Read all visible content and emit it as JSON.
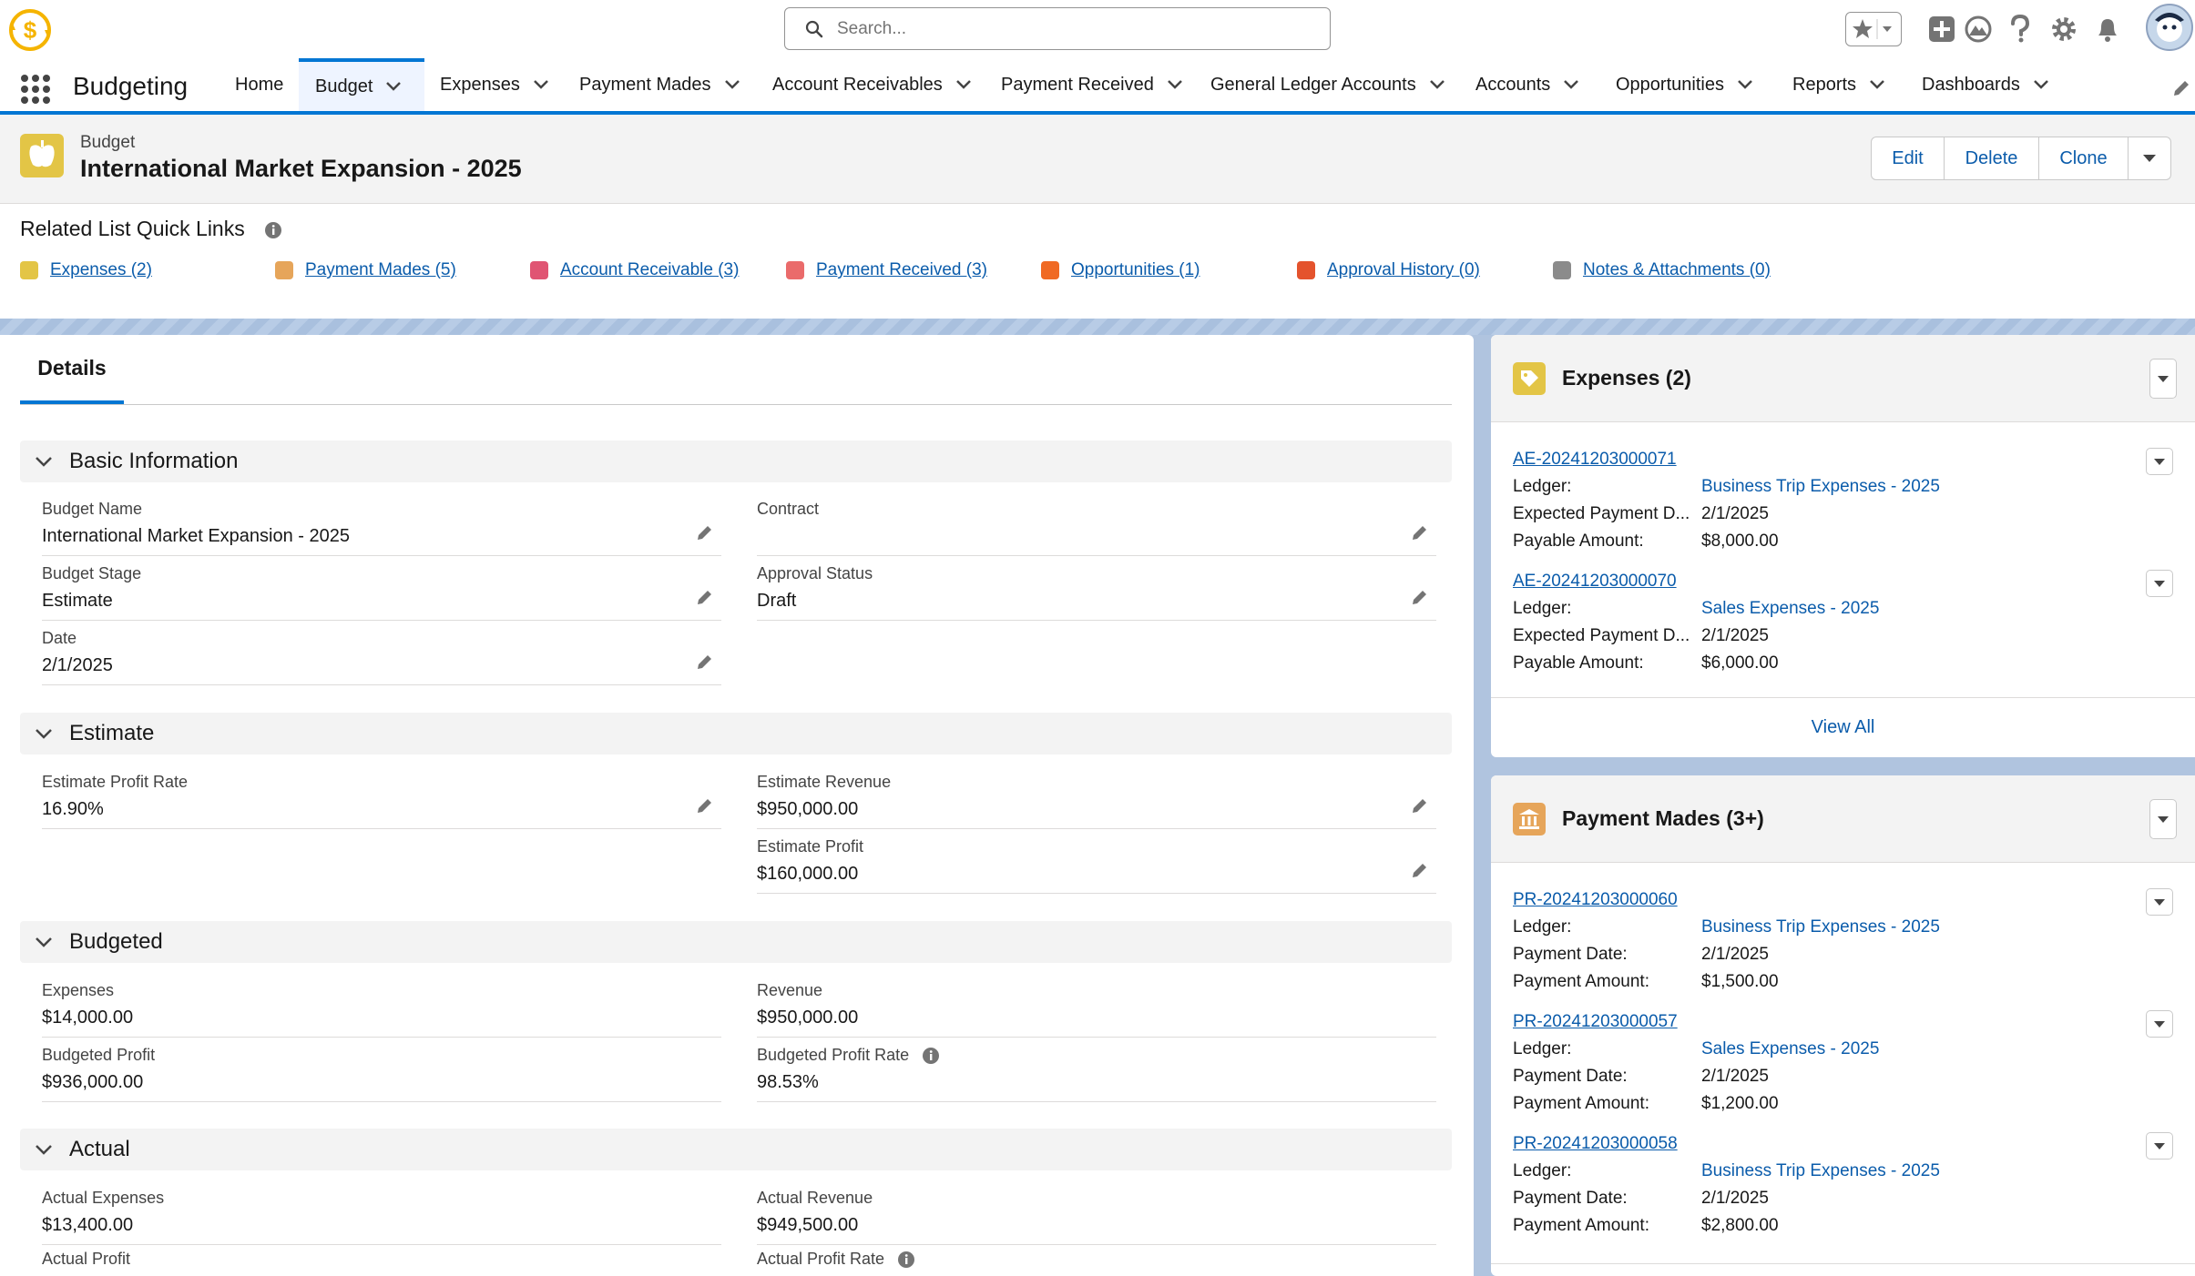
{
  "header": {
    "search_placeholder": "Search...",
    "icons": [
      "app-logo-icon",
      "search-icon",
      "favorites-star-icon",
      "global-add-icon",
      "trailhead-icon",
      "help-icon",
      "setup-gear-icon",
      "notifications-bell-icon",
      "user-avatar"
    ]
  },
  "nav": {
    "app_name": "Budgeting",
    "items": [
      {
        "label": "Home"
      },
      {
        "label": "Budget"
      },
      {
        "label": "Expenses"
      },
      {
        "label": "Payment Mades"
      },
      {
        "label": "Account Receivables"
      },
      {
        "label": "Payment Received"
      },
      {
        "label": "General Ledger Accounts"
      },
      {
        "label": "Accounts"
      },
      {
        "label": "Opportunities"
      },
      {
        "label": "Reports"
      },
      {
        "label": "Dashboards"
      }
    ]
  },
  "record": {
    "object_label": "Budget",
    "title": "International Market Expansion - 2025",
    "actions": {
      "edit": "Edit",
      "delete": "Delete",
      "clone": "Clone"
    }
  },
  "quick_links": {
    "title": "Related List Quick Links",
    "links": [
      {
        "label": "Expenses (2)",
        "color": "#e3c546"
      },
      {
        "label": "Payment Mades (5)",
        "color": "#e6a55a"
      },
      {
        "label": "Account Receivable (3)",
        "color": "#e05573"
      },
      {
        "label": "Payment Received (3)",
        "color": "#ea6b6b"
      },
      {
        "label": "Opportunities (1)",
        "color": "#f06a24"
      },
      {
        "label": "Approval History (0)",
        "color": "#e4532d"
      },
      {
        "label": "Notes & Attachments (0)",
        "color": "#8b8b8b"
      }
    ]
  },
  "details": {
    "tab_label": "Details",
    "sections": {
      "basic": "Basic Information",
      "estimate": "Estimate",
      "budgeted": "Budgeted",
      "actual": "Actual"
    },
    "fields": {
      "budget_name": {
        "label": "Budget Name",
        "value": "International Market Expansion - 2025"
      },
      "contract": {
        "label": "Contract",
        "value": ""
      },
      "budget_stage": {
        "label": "Budget Stage",
        "value": "Estimate"
      },
      "approval_status": {
        "label": "Approval Status",
        "value": "Draft"
      },
      "date": {
        "label": "Date",
        "value": "2/1/2025"
      },
      "estimate_profit_rate": {
        "label": "Estimate Profit Rate",
        "value": "16.90%"
      },
      "estimate_revenue": {
        "label": "Estimate Revenue",
        "value": "$950,000.00"
      },
      "estimate_profit": {
        "label": "Estimate Profit",
        "value": "$160,000.00"
      },
      "expenses": {
        "label": "Expenses",
        "value": "$14,000.00"
      },
      "revenue": {
        "label": "Revenue",
        "value": "$950,000.00"
      },
      "budgeted_profit": {
        "label": "Budgeted Profit",
        "value": "$936,000.00"
      },
      "budgeted_profit_rate": {
        "label": "Budgeted Profit Rate",
        "value": "98.53%"
      },
      "actual_expenses": {
        "label": "Actual Expenses",
        "value": "$13,400.00"
      },
      "actual_revenue": {
        "label": "Actual Revenue",
        "value": "$949,500.00"
      },
      "actual_profit": {
        "label": "Actual Profit",
        "value": ""
      },
      "actual_profit_rate": {
        "label": "Actual Profit Rate",
        "value": ""
      }
    }
  },
  "expenses_panel": {
    "title": "Expenses (2)",
    "view_all": "View All",
    "records": [
      {
        "id": "AE-20241203000071",
        "ledger_label": "Ledger:",
        "ledger": "Business Trip Expenses - 2025",
        "date_label": "Expected Payment D...",
        "date": "2/1/2025",
        "amount_label": "Payable Amount:",
        "amount": "$8,000.00"
      },
      {
        "id": "AE-20241203000070",
        "ledger_label": "Ledger:",
        "ledger": "Sales Expenses - 2025",
        "date_label": "Expected Payment D...",
        "date": "2/1/2025",
        "amount_label": "Payable Amount:",
        "amount": "$6,000.00"
      }
    ]
  },
  "payments_panel": {
    "title": "Payment Mades (3+)",
    "records": [
      {
        "id": "PR-20241203000060",
        "ledger_label": "Ledger:",
        "ledger": "Business Trip Expenses - 2025",
        "date_label": "Payment Date:",
        "date": "2/1/2025",
        "amount_label": "Payment Amount:",
        "amount": "$1,500.00"
      },
      {
        "id": "PR-20241203000057",
        "ledger_label": "Ledger:",
        "ledger": "Sales Expenses - 2025",
        "date_label": "Payment Date:",
        "date": "2/1/2025",
        "amount_label": "Payment Amount:",
        "amount": "$1,200.00"
      },
      {
        "id": "PR-20241203000058",
        "ledger_label": "Ledger:",
        "ledger": "Business Trip Expenses - 2025",
        "date_label": "Payment Date:",
        "date": "2/1/2025",
        "amount_label": "Payment Amount:",
        "amount": "$2,800.00"
      }
    ]
  },
  "colors": {
    "brand": "#0176d3",
    "link": "#0b5cab",
    "budget_icon": "#e3c546",
    "payment_icon": "#e6a55a"
  }
}
